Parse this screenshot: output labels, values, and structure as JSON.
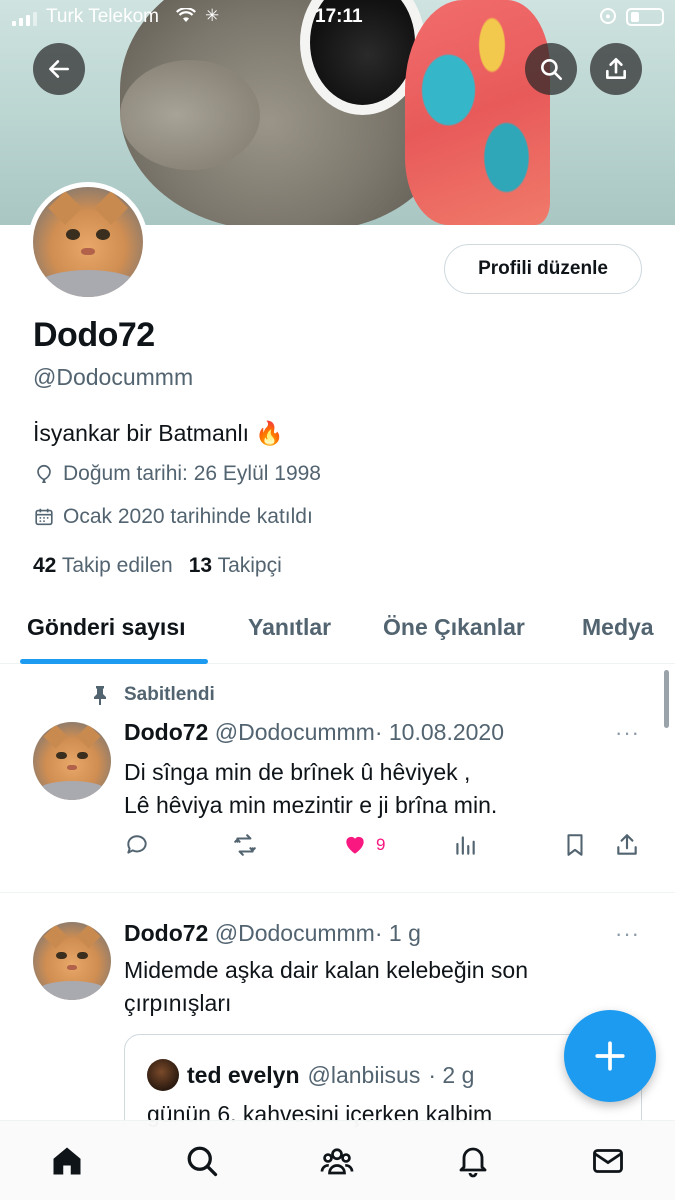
{
  "status_bar": {
    "carrier": "Turk Telekom",
    "time": "17:11"
  },
  "profile": {
    "display_name": "Dodo72",
    "handle": "@Dodocummm",
    "bio": "İsyankar bir Batmanlı 🔥",
    "birthday": "Doğum tarihi: 26 Eylül 1998",
    "joined": "Ocak 2020 tarihinde katıldı",
    "following_count": "42",
    "following_label": "Takip edilen",
    "followers_count": "13",
    "followers_label": "Takipçi",
    "edit_button": "Profili düzenle"
  },
  "tabs": [
    {
      "label": "Gönderi sayısı",
      "active": true
    },
    {
      "label": "Yanıtlar",
      "active": false
    },
    {
      "label": "Öne Çıkanlar",
      "active": false
    },
    {
      "label": "Medya",
      "active": false
    }
  ],
  "posts": [
    {
      "pinned_label": "Sabitlendi",
      "name": "Dodo72",
      "handle": "@Dodocummm",
      "date": "· 10.08.2020",
      "more": "···",
      "lines": [
        "Di sînga min de brînek û hêviyek ,",
        "Lê hêviya min mezintir e ji brîna min."
      ],
      "like_count": "9"
    },
    {
      "name": "Dodo72",
      "handle": "@Dodocummm",
      "date": "· 1 g",
      "more": "···",
      "lines": [
        "Midemde aşka dair kalan kelebeğin son",
        "çırpınışları"
      ],
      "quote": {
        "name": "ted evelyn",
        "handle": "@lanbiisus",
        "date": "· 2 g",
        "text": "günün 6. kahvesini içerken kalbim"
      }
    }
  ],
  "colors": {
    "accent": "#1d9bf0",
    "like": "#f91880",
    "secondary_text": "#536471"
  },
  "icons": [
    "back-arrow-icon",
    "search-icon",
    "share-icon",
    "balloon-icon",
    "calendar-icon",
    "pin-icon",
    "reply-icon",
    "retweet-icon",
    "heart-icon",
    "analytics-icon",
    "bookmark-icon",
    "home-icon",
    "communities-icon",
    "bell-icon",
    "mail-icon",
    "plus-icon"
  ]
}
